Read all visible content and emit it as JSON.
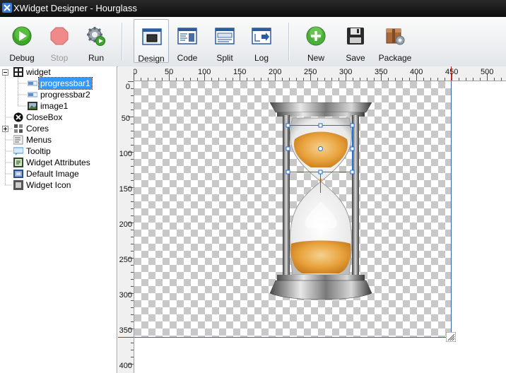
{
  "window": {
    "title": "XWidget Designer - Hourglass"
  },
  "toolbar": {
    "debug_label": "Debug",
    "stop_label": "Stop",
    "run_label": "Run",
    "design_label": "Design",
    "code_label": "Code",
    "split_label": "Split",
    "log_label": "Log",
    "new_label": "New",
    "save_label": "Save",
    "package_label": "Package"
  },
  "tree": {
    "root": "widget",
    "children": [
      "progressbar1",
      "progressbar2",
      "image1"
    ],
    "items": [
      "CloseBox",
      "Cores",
      "Menus",
      "Tooltip",
      "Widget Attributes",
      "Default Image",
      "Widget Icon"
    ]
  },
  "ruler": {
    "top_ticks": [
      "0",
      "50",
      "100",
      "150",
      "200",
      "250",
      "300",
      "350",
      "400",
      "450",
      "500"
    ],
    "left_ticks": [
      "0",
      "50",
      "100",
      "150",
      "200",
      "250",
      "300",
      "350",
      "400"
    ]
  },
  "colors": {
    "accent": "#3399ff",
    "selection": "#1e6fd9",
    "sand": "#e8a23c"
  }
}
